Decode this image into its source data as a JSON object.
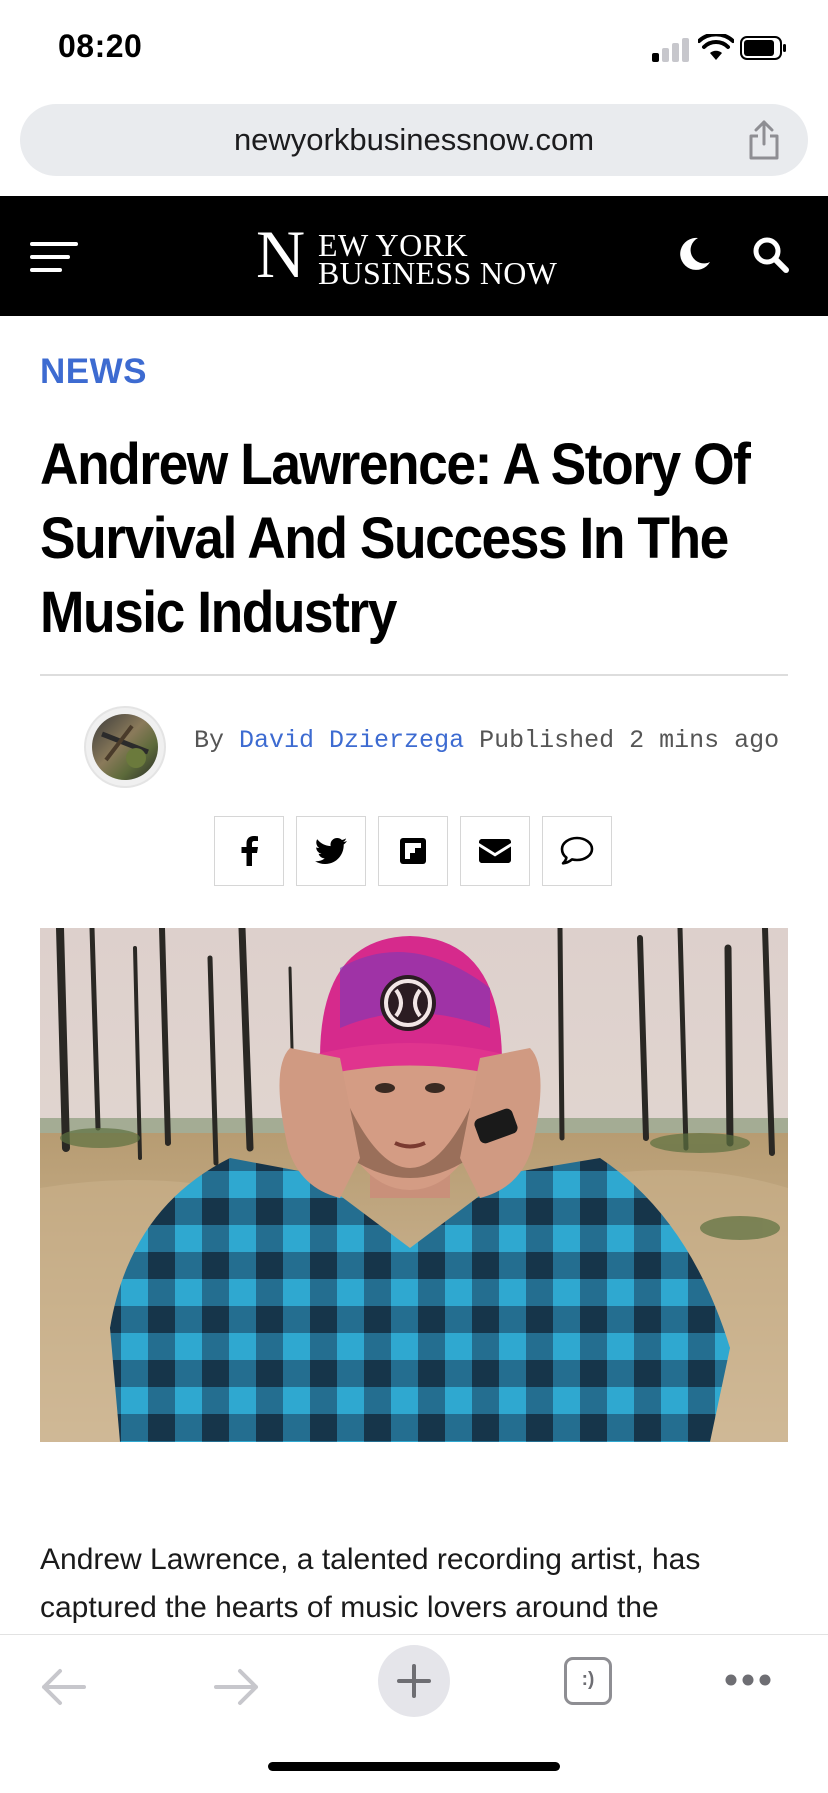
{
  "status_bar": {
    "time": "08:20"
  },
  "browser": {
    "url": "newyorkbusinessnow.com"
  },
  "site": {
    "logo": {
      "initial": "N",
      "line1": "EW YORK",
      "line2": "BUSINESS NOW"
    }
  },
  "article": {
    "category": "NEWS",
    "headline": "Andrew Lawrence: A Story Of Survival And Success In The Music Industry",
    "byline": {
      "by": "By",
      "author": "David Dzierzega",
      "published_label": "Published",
      "time_ago": "2 mins ago"
    },
    "share_buttons": [
      "facebook-icon",
      "twitter-icon",
      "flipboard-icon",
      "email-icon",
      "comment-icon"
    ],
    "body_start": "Andrew Lawrence, a talented recording artist, has captured the hearts of music lovers around the"
  },
  "toolbar": {
    "tabs_label": ":)",
    "items": [
      "back-icon",
      "forward-icon",
      "new-tab-icon",
      "tabs-icon",
      "more-icon"
    ]
  }
}
